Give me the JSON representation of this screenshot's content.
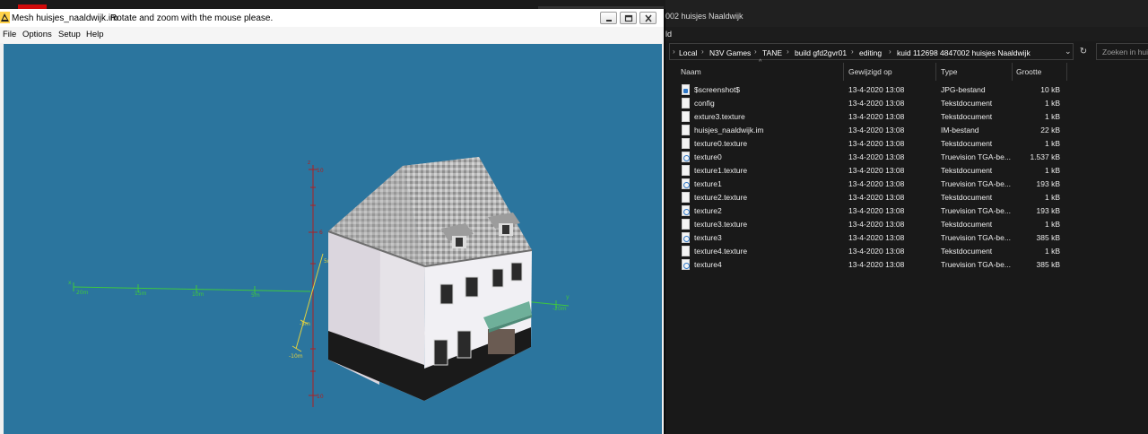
{
  "mesh_viewer": {
    "title": "Mesh huisjes_naaldwijk.im",
    "hint": "Rotate and zoom with the mouse please.",
    "menu": [
      "File",
      "Options",
      "Setup",
      "Help"
    ],
    "axes": {
      "z_axis_label": "z",
      "z_ticks": [
        "10",
        "6",
        "10"
      ],
      "x_axis_label": "x",
      "x_ticks": [
        "20m",
        "15m",
        "10m",
        "5m"
      ],
      "y_axis_label": "y",
      "y_end_label": "-20m",
      "near_tick_labels": [
        "5m",
        "-5m",
        "-10m"
      ]
    }
  },
  "explorer": {
    "title_partial": "002 huisjes Naaldwijk",
    "ribbon_partial": "ld",
    "breadcrumb": [
      "Local",
      "N3V Games",
      "TANE",
      "build gfd2gvr01",
      "editing",
      "kuid 112698 4847002 huisjes Naaldwijk"
    ],
    "search_placeholder": "Zoeken in huisjes",
    "columns": [
      "Naam",
      "Gewijzigd op",
      "Type",
      "Grootte"
    ],
    "files": [
      {
        "name": "$screenshot$",
        "date": "13-4-2020 13:08",
        "type": "JPG-bestand",
        "size": "10 kB",
        "icon": "image-file-icon"
      },
      {
        "name": "config",
        "date": "13-4-2020 13:08",
        "type": "Tekstdocument",
        "size": "1 kB",
        "icon": "text-file-icon"
      },
      {
        "name": "exture3.texture",
        "date": "13-4-2020 13:08",
        "type": "Tekstdocument",
        "size": "1 kB",
        "icon": "text-file-icon"
      },
      {
        "name": "huisjes_naaldwijk.im",
        "date": "13-4-2020 13:08",
        "type": "IM-bestand",
        "size": "22 kB",
        "icon": "blank-file-icon"
      },
      {
        "name": "texture0.texture",
        "date": "13-4-2020 13:08",
        "type": "Tekstdocument",
        "size": "1 kB",
        "icon": "text-file-icon"
      },
      {
        "name": "texture0",
        "date": "13-4-2020 13:08",
        "type": "Truevision TGA-be...",
        "size": "1.537 kB",
        "icon": "tga-file-icon"
      },
      {
        "name": "texture1.texture",
        "date": "13-4-2020 13:08",
        "type": "Tekstdocument",
        "size": "1 kB",
        "icon": "text-file-icon"
      },
      {
        "name": "texture1",
        "date": "13-4-2020 13:08",
        "type": "Truevision TGA-be...",
        "size": "193 kB",
        "icon": "tga-file-icon"
      },
      {
        "name": "texture2.texture",
        "date": "13-4-2020 13:08",
        "type": "Tekstdocument",
        "size": "1 kB",
        "icon": "text-file-icon"
      },
      {
        "name": "texture2",
        "date": "13-4-2020 13:08",
        "type": "Truevision TGA-be...",
        "size": "193 kB",
        "icon": "tga-file-icon"
      },
      {
        "name": "texture3.texture",
        "date": "13-4-2020 13:08",
        "type": "Tekstdocument",
        "size": "1 kB",
        "icon": "text-file-icon"
      },
      {
        "name": "texture3",
        "date": "13-4-2020 13:08",
        "type": "Truevision TGA-be...",
        "size": "385 kB",
        "icon": "tga-file-icon"
      },
      {
        "name": "texture4.texture",
        "date": "13-4-2020 13:08",
        "type": "Tekstdocument",
        "size": "1 kB",
        "icon": "text-file-icon"
      },
      {
        "name": "texture4",
        "date": "13-4-2020 13:08",
        "type": "Truevision TGA-be...",
        "size": "385 kB",
        "icon": "tga-file-icon"
      }
    ]
  },
  "colors": {
    "viewport_bg": "#2b759e",
    "explorer_bg": "#191919",
    "axis_green": "#3ec83e",
    "axis_yellow": "#e0d040",
    "axis_red": "#b02020",
    "taskbar_red": "#d10a0a"
  }
}
